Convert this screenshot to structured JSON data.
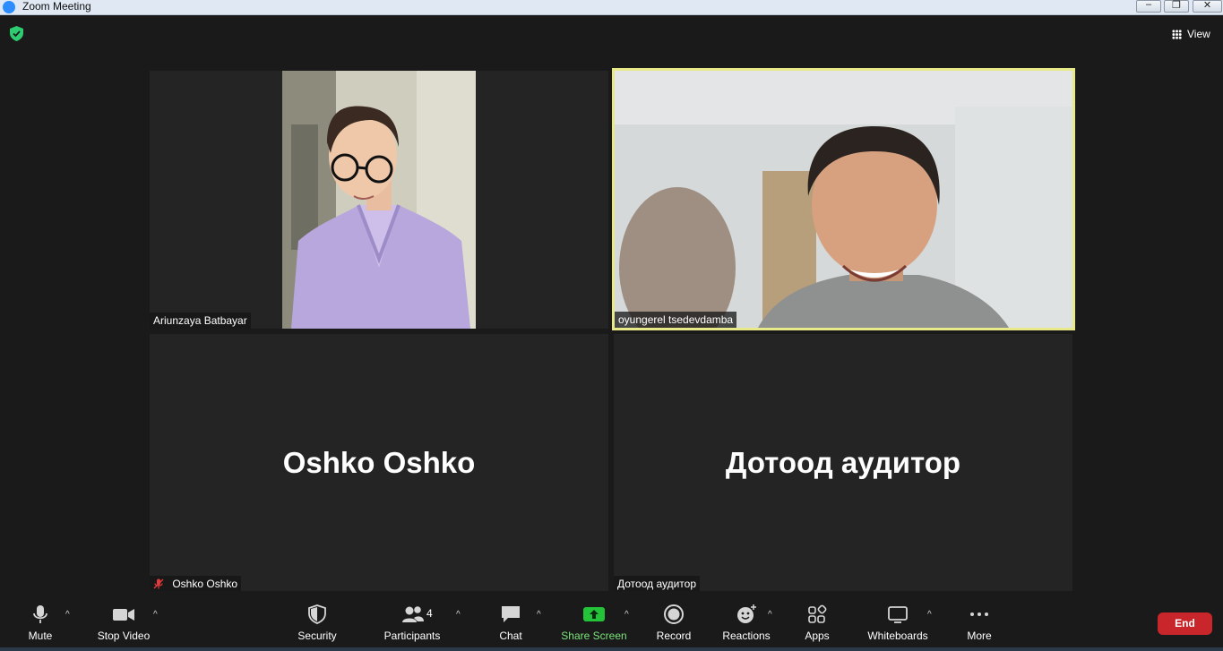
{
  "window": {
    "title": "Zoom Meeting",
    "min": "–",
    "max": "❐",
    "close": "✕"
  },
  "header": {
    "view_label": "View"
  },
  "participants": [
    {
      "name": "Ariunzaya Batbayar",
      "video": true
    },
    {
      "name": "oyungerel tsedevdamba",
      "video": true,
      "active_speaker": true
    },
    {
      "name": "Oshko Oshko",
      "video": false,
      "muted": true,
      "display_name": "Oshko Oshko"
    },
    {
      "name": "Дотоод аудитор",
      "video": false,
      "display_name": "Дотоод аудитор"
    }
  ],
  "toolbar": {
    "mute": "Mute",
    "stop_video": "Stop Video",
    "security": "Security",
    "participants": "Participants",
    "participants_count": "4",
    "chat": "Chat",
    "share_screen": "Share Screen",
    "record": "Record",
    "reactions": "Reactions",
    "apps": "Apps",
    "whiteboards": "Whiteboards",
    "more": "More",
    "end": "End",
    "caret": "^"
  },
  "colors": {
    "active_speaker_border": "#e8ea8a",
    "end_button": "#c8262b",
    "share_green": "#23c43a",
    "shield_green": "#2ecc71"
  }
}
